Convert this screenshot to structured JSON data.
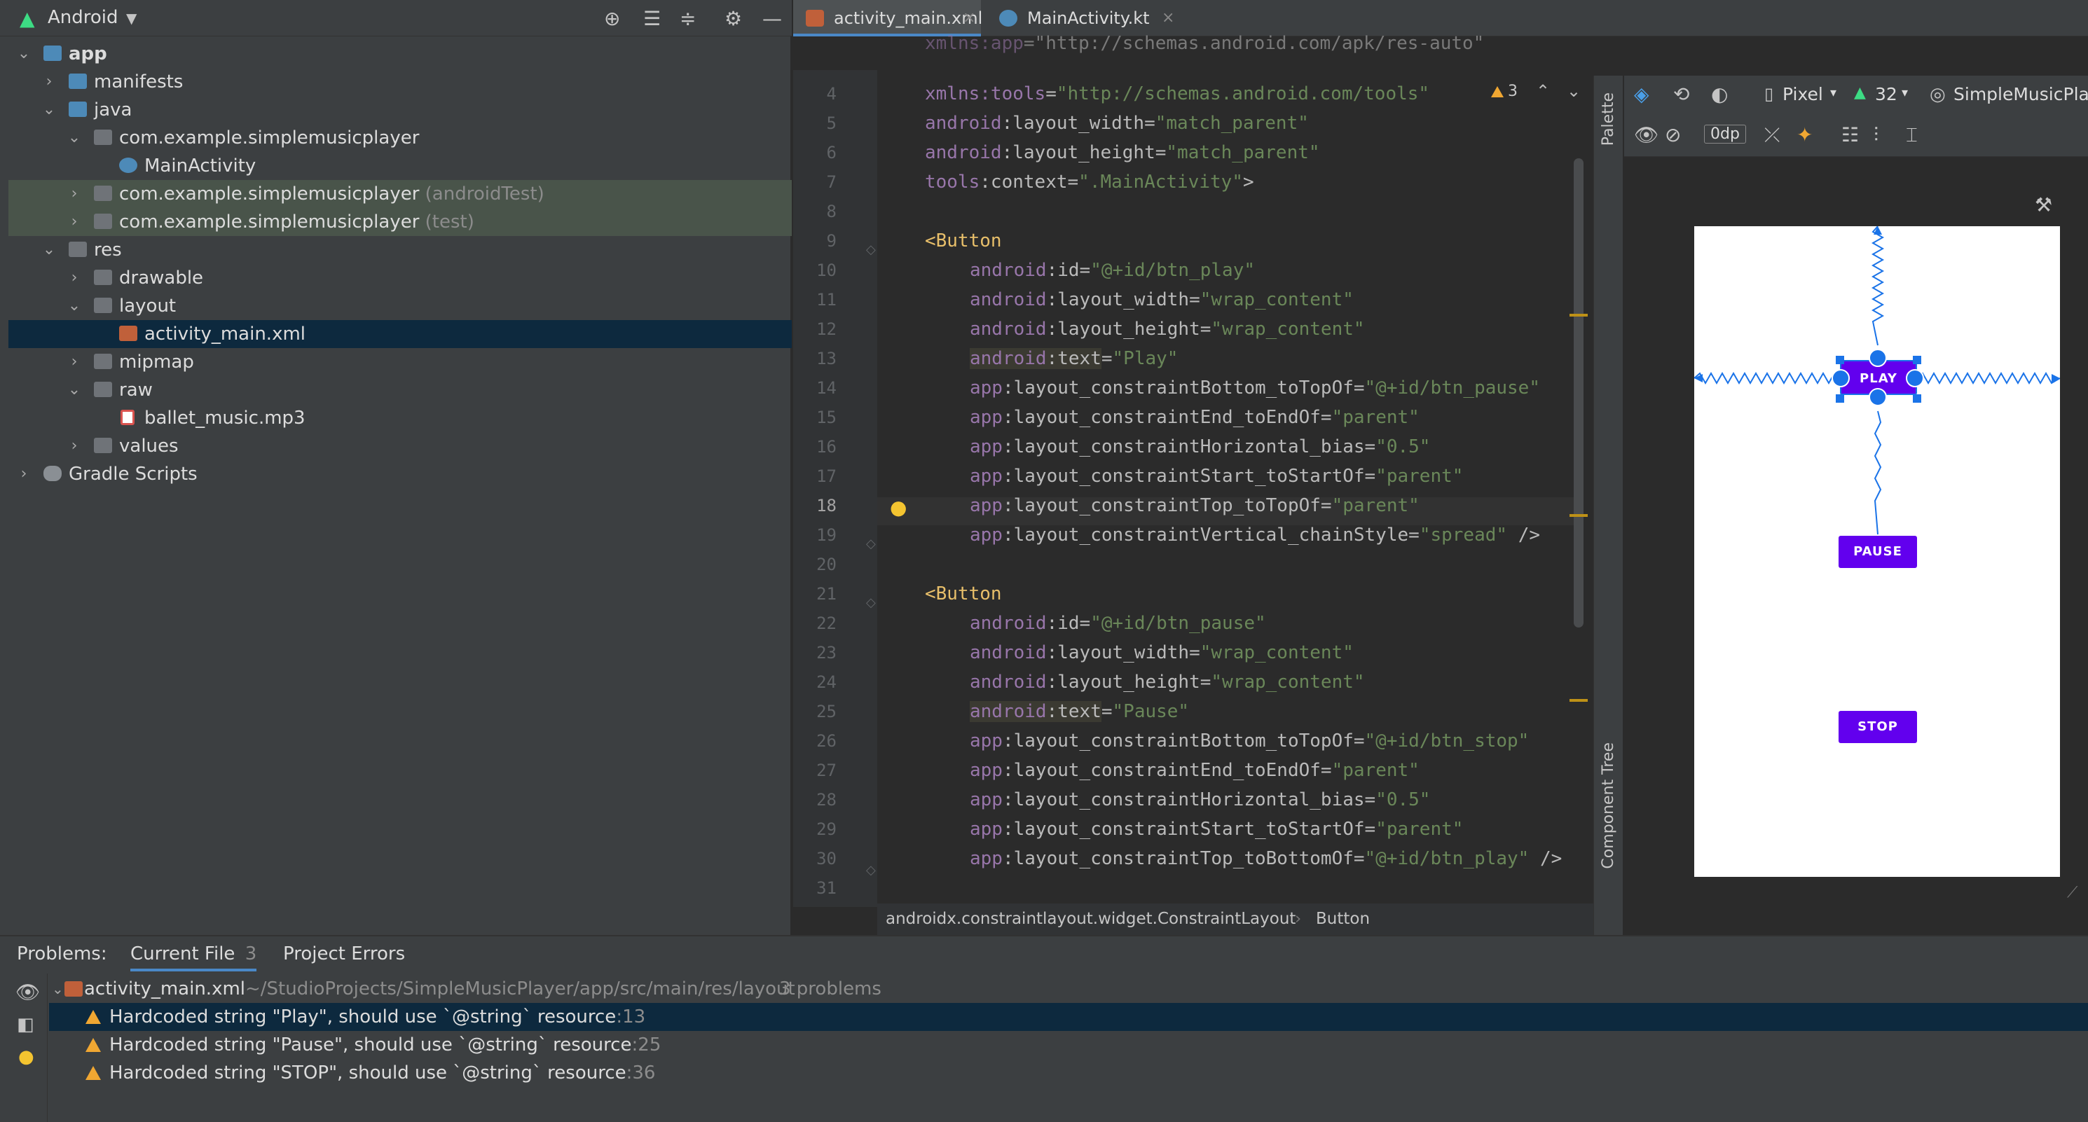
{
  "project_panel": {
    "title": "Android",
    "tree": [
      {
        "label": "app",
        "suffix": ""
      },
      {
        "label": "manifests",
        "suffix": ""
      },
      {
        "label": "java",
        "suffix": ""
      },
      {
        "label": "com.example.simplemusicplayer",
        "suffix": ""
      },
      {
        "label": "MainActivity",
        "suffix": ""
      },
      {
        "label": "com.example.simplemusicplayer",
        "suffix": " (androidTest)"
      },
      {
        "label": "com.example.simplemusicplayer",
        "suffix": " (test)"
      },
      {
        "label": "res",
        "suffix": ""
      },
      {
        "label": "drawable",
        "suffix": ""
      },
      {
        "label": "layout",
        "suffix": ""
      },
      {
        "label": "activity_main.xml",
        "suffix": ""
      },
      {
        "label": "mipmap",
        "suffix": ""
      },
      {
        "label": "raw",
        "suffix": ""
      },
      {
        "label": "ballet_music.mp3",
        "suffix": ""
      },
      {
        "label": "values",
        "suffix": ""
      },
      {
        "label": "Gradle Scripts",
        "suffix": ""
      }
    ]
  },
  "editor_tabs": [
    {
      "label": "activity_main.xml"
    },
    {
      "label": "MainActivity.kt"
    }
  ],
  "editor": {
    "warning_count": "3",
    "lines": [
      {
        "n": "",
        "parts": [
          [
            "ns",
            "xmlns:app"
          ],
          [
            "punc",
            "=\"http://schemas.android.com/apk/res-auto\""
          ]
        ]
      },
      {
        "n": "4",
        "parts": [
          [
            "ns",
            "xmlns:tools"
          ],
          [
            "punc",
            "="
          ],
          [
            "val",
            "\"http://schemas.android.com/tools\""
          ]
        ]
      },
      {
        "n": "5",
        "parts": [
          [
            "ns",
            "android"
          ],
          [
            "attr",
            ":layout_width"
          ],
          [
            "punc",
            "="
          ],
          [
            "val",
            "\"match_parent\""
          ]
        ]
      },
      {
        "n": "6",
        "parts": [
          [
            "ns",
            "android"
          ],
          [
            "attr",
            ":layout_height"
          ],
          [
            "punc",
            "="
          ],
          [
            "val",
            "\"match_parent\""
          ]
        ]
      },
      {
        "n": "7",
        "parts": [
          [
            "ns",
            "tools"
          ],
          [
            "attr",
            ":context"
          ],
          [
            "punc",
            "="
          ],
          [
            "val",
            "\".MainActivity\""
          ],
          [
            "punc",
            ">"
          ]
        ]
      },
      {
        "n": "8",
        "parts": []
      },
      {
        "n": "9",
        "parts": [
          [
            "tag",
            "<Button"
          ]
        ]
      },
      {
        "n": "10",
        "parts": [
          [
            "ns",
            "android"
          ],
          [
            "attr",
            ":id"
          ],
          [
            "punc",
            "="
          ],
          [
            "val",
            "\"@+id/btn_play\""
          ]
        ]
      },
      {
        "n": "11",
        "parts": [
          [
            "ns",
            "android"
          ],
          [
            "attr",
            ":layout_width"
          ],
          [
            "punc",
            "="
          ],
          [
            "val",
            "\"wrap_content\""
          ]
        ]
      },
      {
        "n": "12",
        "parts": [
          [
            "ns",
            "android"
          ],
          [
            "attr",
            ":layout_height"
          ],
          [
            "punc",
            "="
          ],
          [
            "val",
            "\"wrap_content\""
          ]
        ]
      },
      {
        "n": "13",
        "parts": [
          [
            "ns",
            "android"
          ],
          [
            "attr",
            ":text"
          ],
          [
            "punc",
            "="
          ],
          [
            "val",
            "\"Play\""
          ]
        ]
      },
      {
        "n": "14",
        "parts": [
          [
            "ns",
            "app"
          ],
          [
            "attr",
            ":layout_constraintBottom_toTopOf"
          ],
          [
            "punc",
            "="
          ],
          [
            "val",
            "\"@+id/btn_pause\""
          ]
        ]
      },
      {
        "n": "15",
        "parts": [
          [
            "ns",
            "app"
          ],
          [
            "attr",
            ":layout_constraintEnd_toEndOf"
          ],
          [
            "punc",
            "="
          ],
          [
            "val",
            "\"parent\""
          ]
        ]
      },
      {
        "n": "16",
        "parts": [
          [
            "ns",
            "app"
          ],
          [
            "attr",
            ":layout_constraintHorizontal_bias"
          ],
          [
            "punc",
            "="
          ],
          [
            "val",
            "\"0.5\""
          ]
        ]
      },
      {
        "n": "17",
        "parts": [
          [
            "ns",
            "app"
          ],
          [
            "attr",
            ":layout_constraintStart_toStartOf"
          ],
          [
            "punc",
            "="
          ],
          [
            "val",
            "\"parent\""
          ]
        ]
      },
      {
        "n": "18",
        "parts": [
          [
            "ns",
            "app"
          ],
          [
            "attr",
            ":layout_constraintTop_toTopOf"
          ],
          [
            "punc",
            "="
          ],
          [
            "val",
            "\"parent\""
          ]
        ]
      },
      {
        "n": "19",
        "parts": [
          [
            "ns",
            "app"
          ],
          [
            "attr",
            ":layout_constraintVertical_chainStyle"
          ],
          [
            "punc",
            "="
          ],
          [
            "val",
            "\"spread\""
          ],
          [
            "punc",
            " />"
          ]
        ]
      },
      {
        "n": "20",
        "parts": []
      },
      {
        "n": "21",
        "parts": [
          [
            "tag",
            "<Button"
          ]
        ]
      },
      {
        "n": "22",
        "parts": [
          [
            "ns",
            "android"
          ],
          [
            "attr",
            ":id"
          ],
          [
            "punc",
            "="
          ],
          [
            "val",
            "\"@+id/btn_pause\""
          ]
        ]
      },
      {
        "n": "23",
        "parts": [
          [
            "ns",
            "android"
          ],
          [
            "attr",
            ":layout_width"
          ],
          [
            "punc",
            "="
          ],
          [
            "val",
            "\"wrap_content\""
          ]
        ]
      },
      {
        "n": "24",
        "parts": [
          [
            "ns",
            "android"
          ],
          [
            "attr",
            ":layout_height"
          ],
          [
            "punc",
            "="
          ],
          [
            "val",
            "\"wrap_content\""
          ]
        ]
      },
      {
        "n": "25",
        "parts": [
          [
            "ns",
            "android"
          ],
          [
            "attr",
            ":text"
          ],
          [
            "punc",
            "="
          ],
          [
            "val",
            "\"Pause\""
          ]
        ]
      },
      {
        "n": "26",
        "parts": [
          [
            "ns",
            "app"
          ],
          [
            "attr",
            ":layout_constraintBottom_toTopOf"
          ],
          [
            "punc",
            "="
          ],
          [
            "val",
            "\"@+id/btn_stop\""
          ]
        ]
      },
      {
        "n": "27",
        "parts": [
          [
            "ns",
            "app"
          ],
          [
            "attr",
            ":layout_constraintEnd_toEndOf"
          ],
          [
            "punc",
            "="
          ],
          [
            "val",
            "\"parent\""
          ]
        ]
      },
      {
        "n": "28",
        "parts": [
          [
            "ns",
            "app"
          ],
          [
            "attr",
            ":layout_constraintHorizontal_bias"
          ],
          [
            "punc",
            "="
          ],
          [
            "val",
            "\"0.5\""
          ]
        ]
      },
      {
        "n": "29",
        "parts": [
          [
            "ns",
            "app"
          ],
          [
            "attr",
            ":layout_constraintStart_toStartOf"
          ],
          [
            "punc",
            "="
          ],
          [
            "val",
            "\"parent\""
          ]
        ]
      },
      {
        "n": "30",
        "parts": [
          [
            "ns",
            "app"
          ],
          [
            "attr",
            ":layout_constraintTop_toBottomOf"
          ],
          [
            "punc",
            "="
          ],
          [
            "val",
            "\"@+id/btn_play\""
          ],
          [
            "punc",
            " />"
          ]
        ]
      },
      {
        "n": "31",
        "parts": []
      }
    ],
    "breadcrumb": [
      "androidx.constraintlayout.widget.ConstraintLayout",
      "Button"
    ]
  },
  "design": {
    "device": "Pixel",
    "api": "32",
    "theme": "SimpleMusicPla",
    "margin": "0dp",
    "palette_label": "Palette",
    "component_tree_label": "Component Tree",
    "buttons": {
      "play": "PLAY",
      "pause": "PAUSE",
      "stop": "STOP"
    },
    "button_color": "#6200ee",
    "selection_color": "#1a73e8"
  },
  "problems": {
    "label": "Problems:",
    "tabs": {
      "current_file": "Current File",
      "current_file_count": "3",
      "project_errors": "Project Errors"
    },
    "file": {
      "name": "activity_main.xml",
      "path": "~/StudioProjects/SimpleMusicPlayer/app/src/main/res/layout",
      "count": "3 problems"
    },
    "items": [
      {
        "text": "Hardcoded string \"Play\", should use `@string` resource",
        "line": ":13"
      },
      {
        "text": "Hardcoded string \"Pause\", should use `@string` resource",
        "line": ":25"
      },
      {
        "text": "Hardcoded string \"STOP\", should use `@string` resource",
        "line": ":36"
      }
    ]
  },
  "colors": {
    "warning": "#f0a732",
    "selection": "#0d293e",
    "accent": "#4a88c7"
  }
}
